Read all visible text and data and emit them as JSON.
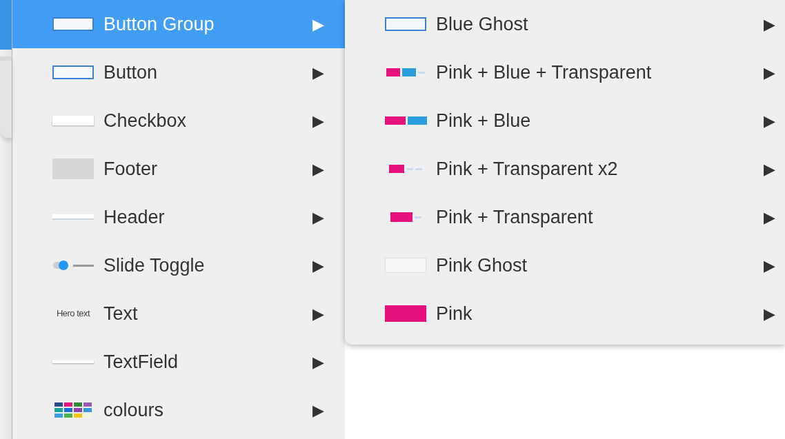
{
  "menu": {
    "items": [
      {
        "label": "Button Group",
        "selected": true,
        "kind": "outline-button",
        "arrow": "▶"
      },
      {
        "label": "Button",
        "selected": false,
        "kind": "outline-button",
        "arrow": "▶"
      },
      {
        "label": "Checkbox",
        "selected": false,
        "kind": "checkbox",
        "arrow": "▶"
      },
      {
        "label": "Footer",
        "selected": false,
        "kind": "footer",
        "arrow": "▶"
      },
      {
        "label": "Header",
        "selected": false,
        "kind": "header",
        "arrow": "▶"
      },
      {
        "label": "Slide Toggle",
        "selected": false,
        "kind": "toggle",
        "arrow": "▶"
      },
      {
        "label": "Text",
        "selected": false,
        "kind": "hero-text",
        "thumbnail_text": "Hero text",
        "arrow": "▶"
      },
      {
        "label": "TextField",
        "selected": false,
        "kind": "textfield",
        "arrow": "▶"
      },
      {
        "label": "colours",
        "selected": false,
        "kind": "swatches",
        "arrow": "▶"
      }
    ]
  },
  "submenu": {
    "items": [
      {
        "label": "Blue Ghost",
        "kind": "blue-ghost",
        "arrow": "▶"
      },
      {
        "label": "Pink + Blue + Transparent",
        "kind": "pink-blue-transparent",
        "arrow": "▶"
      },
      {
        "label": "Pink + Blue",
        "kind": "pink-blue",
        "arrow": "▶"
      },
      {
        "label": "Pink + Transparent x2",
        "kind": "pink-transparent-x2",
        "arrow": "▶"
      },
      {
        "label": "Pink + Transparent",
        "kind": "pink-transparent",
        "arrow": "▶"
      },
      {
        "label": "Pink Ghost",
        "kind": "pink-ghost",
        "arrow": "▶"
      },
      {
        "label": "Pink",
        "kind": "pink",
        "arrow": "▶"
      }
    ]
  }
}
